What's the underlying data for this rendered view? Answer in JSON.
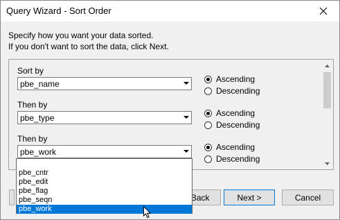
{
  "window": {
    "title": "Query Wizard - Sort Order"
  },
  "intro": {
    "line1": "Specify how you want your data sorted.",
    "line2": "If you don't want to sort the data, click Next."
  },
  "groups": [
    {
      "label": "Sort by",
      "value": "pbe_name",
      "asc_label": "Ascending",
      "desc_label": "Descending",
      "order": "Ascending"
    },
    {
      "label": "Then by",
      "value": "pbe_type",
      "asc_label": "Ascending",
      "desc_label": "Descending",
      "order": "Ascending"
    },
    {
      "label": "Then by",
      "value": "pbe_work",
      "asc_label": "Ascending",
      "desc_label": "Descending",
      "order": "Ascending"
    }
  ],
  "dropdown": {
    "items": [
      "",
      "pbe_cntr",
      "pbe_edit",
      "pbe_flag",
      "pbe_seqn",
      "pbe_work"
    ],
    "selected": "pbe_work"
  },
  "buttons": {
    "back": "< Back",
    "next": "Next >",
    "cancel": "Cancel"
  },
  "icons": {
    "close": "close-icon",
    "dropdown_arrow": "chevron-down-icon",
    "scroll_up": "scroll-up-icon",
    "scroll_down": "scroll-down-icon",
    "pointer": "mouse-pointer-icon"
  },
  "colors": {
    "selection": "#0078d7",
    "dialog_bg": "#f0f0f0"
  }
}
